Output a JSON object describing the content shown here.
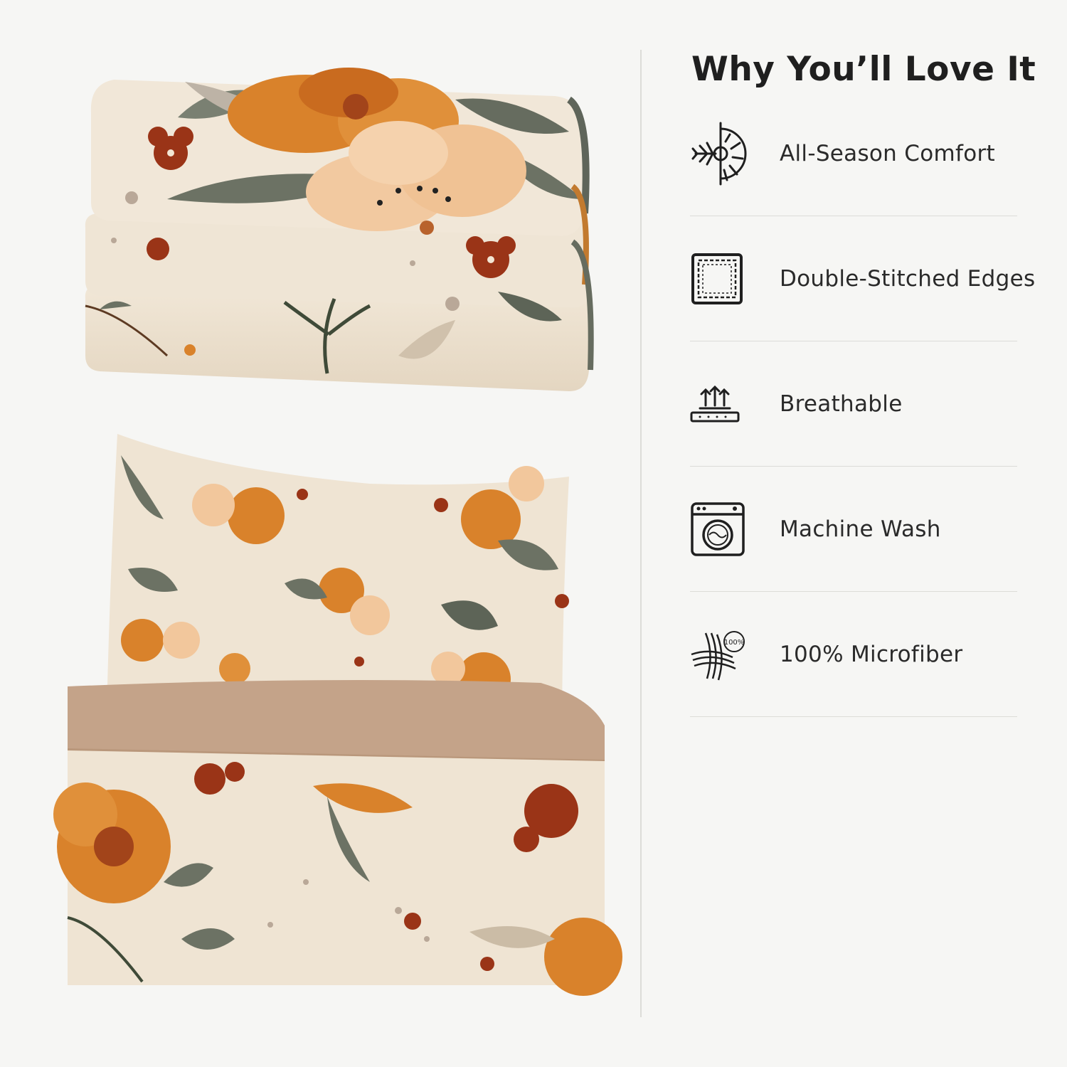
{
  "heading": "Why You’ll Love It",
  "features": [
    {
      "label": "All-Season Comfort",
      "icon": "sun-snowflake-icon"
    },
    {
      "label": "Double-Stitched Edges",
      "icon": "stitched-square-icon"
    },
    {
      "label": "Breathable",
      "icon": "breathable-fabric-icon"
    },
    {
      "label": "Machine Wash",
      "icon": "washing-machine-icon"
    },
    {
      "label": "100% Microfiber",
      "icon": "microfiber-100-icon"
    }
  ],
  "microfiber_badge": "100%",
  "colors": {
    "background": "#f6f6f4",
    "cream": "#efe4d3",
    "burnt_orange": "#d9822b",
    "rust_red": "#9a3417",
    "sage_gray": "#6e7566",
    "taupe_band": "#c4a389",
    "peach": "#f2c79c"
  }
}
